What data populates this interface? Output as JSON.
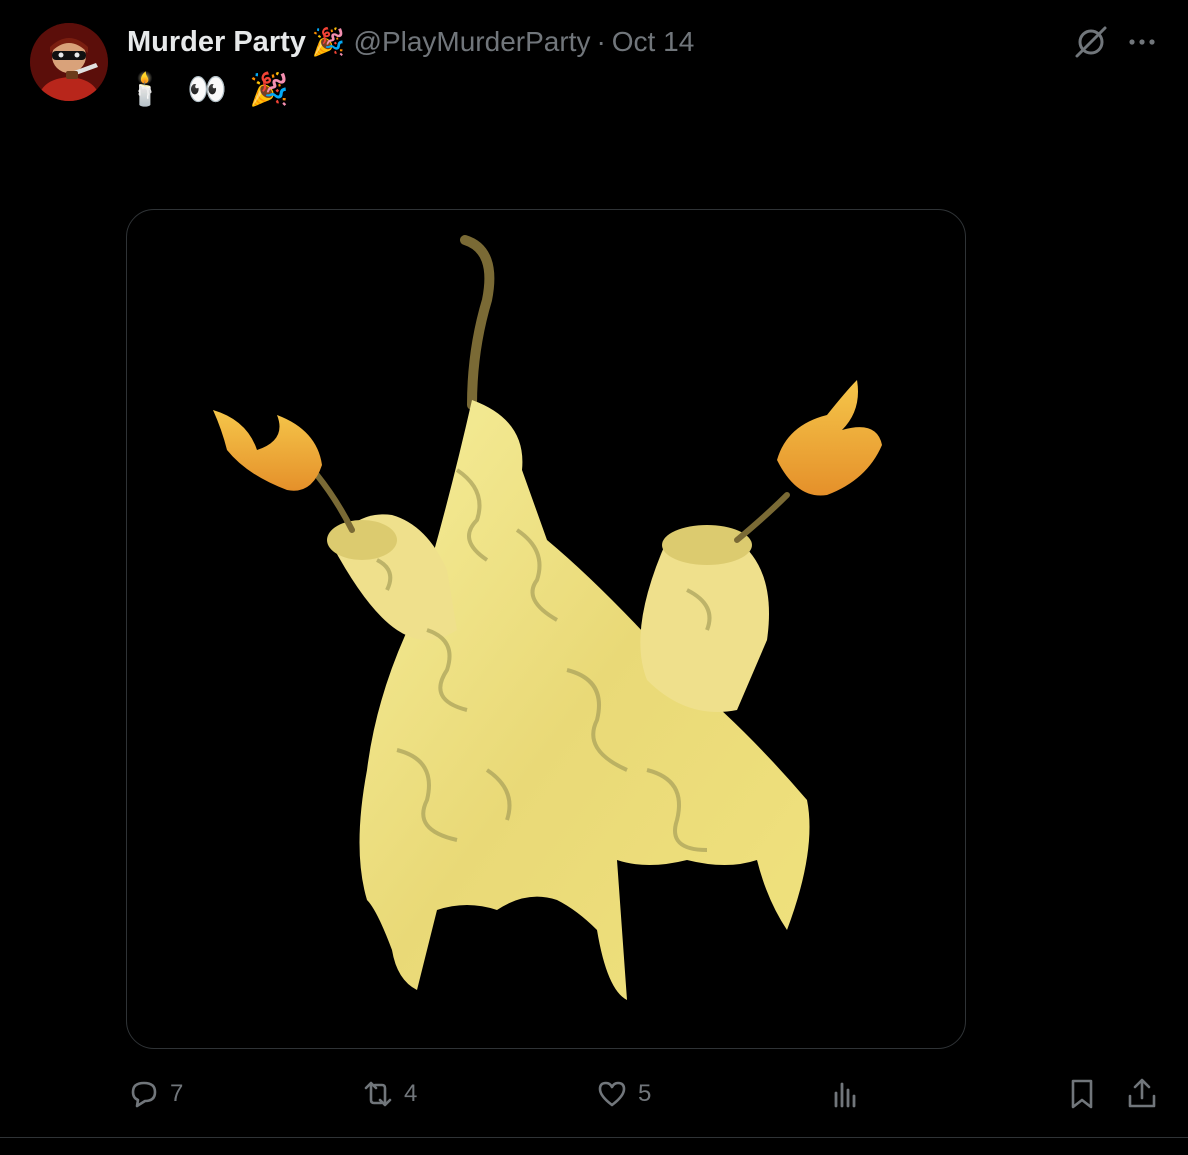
{
  "tweet": {
    "display_name": "Murder Party",
    "name_emoji": "🎉",
    "handle": "@PlayMurderParty",
    "separator": "·",
    "date": "Oct 14",
    "text": "🕯️ 👀 🎉",
    "media_alt": "3D render of a melting yellow candle-like creature with two lit fuse candles"
  },
  "metrics": {
    "replies": "7",
    "reposts": "4",
    "likes": "5"
  },
  "icons": {
    "reply": "reply-icon",
    "repost": "repost-icon",
    "like": "like-icon",
    "views": "views-icon",
    "bookmark": "bookmark-icon",
    "share": "share-icon",
    "grok": "grok-icon",
    "more": "more-icon"
  },
  "colors": {
    "background": "#000000",
    "text_primary": "#e7e9ea",
    "text_secondary": "#71767b",
    "border": "#2f3336"
  }
}
